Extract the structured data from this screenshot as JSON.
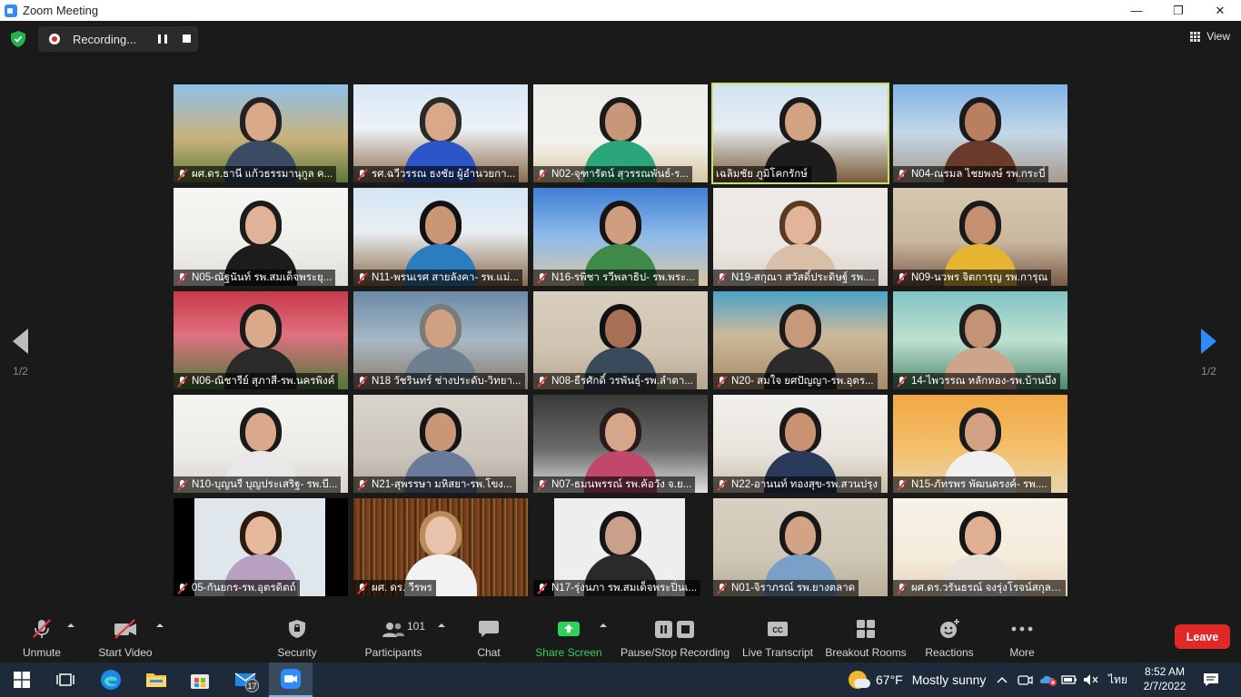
{
  "window": {
    "title": "Zoom Meeting"
  },
  "recording": {
    "label": "Recording..."
  },
  "view": {
    "label": "View"
  },
  "pages": {
    "left": "1/2",
    "right": "1/2"
  },
  "participants_tiles": [
    "ผศ.ดร.ธานี แก้วธรรมานุกูล ค...",
    "รศ.ฉวีวรรณ ธงชัย ผู้อำนวยกา...",
    "N02-จุฑารัตน์ สุวรรณพันธ์-ร...",
    "เฉลิมชัย ภูมิโคกรักษ์",
    "N04-ณรมล ไชยพงษ์ รพ.กระบี่",
    "N05-ณัฐนันท์ รพ.สมเด็จพระยุ...",
    "N11-พรนเรศ สายลังคา- รพ.แม่...",
    "N16-รพิชา รวีพลาธิป- รพ.พระ...",
    "N19-สกุณา สวัสดิ์ประดิษฐ์ รพ....",
    "N09-นวพร จิตการุญ รพ.การุณ",
    "N06-ณิชารีย์ สุภาสี-รพ.นครพิงค์",
    "N18 วัชรินทร์ ช่างประดับ-วิทยา...",
    "N08-ธีรศักดิ์ วรพันธุ์-รพ.ลำตา...",
    "N20- สมใจ ยศปัญญา-รพ.อุตร...",
    "14-ไพวรรณ หลักทอง-รพ.บ้านบึง",
    "N10-บุญนรี บุญประเสริฐ- รพ.บี...",
    "N21-สุพรรษา มหิสยา-รพ.โขง...",
    "N07-ธมนพรรณ์ รพ.ค้อวัง จ.ย...",
    "N22-อานนท์ ทองสุข-รพ.สวนปรุง",
    "N15-ภัทรพร พัฒนดรงค์- รพ....",
    "05-กันยกร-รพ.อุตรดิตถ์",
    "ผศ. ดร. วีรพร",
    "N17-รุ่งนภา รพ.สมเด็จพระปิ่นเ...",
    "N01-จิราภรณ์ รพ.ยางตลาด",
    "ผศ.ดร.วรันธรณ์ จงรุ่งโรจน์สกุล ..."
  ],
  "toolbar": {
    "unmute": "Unmute",
    "start_video": "Start Video",
    "security": "Security",
    "participants": "Participants",
    "participants_count": "101",
    "chat": "Chat",
    "share_screen": "Share Screen",
    "pause_stop": "Pause/Stop Recording",
    "live_transcript": "Live Transcript",
    "breakout": "Breakout Rooms",
    "reactions": "Reactions",
    "more": "More",
    "leave": "Leave"
  },
  "taskbar": {
    "mail_badge": "17",
    "weather_temp": "67°F",
    "weather_text": "Mostly sunny",
    "ime": "ไทย",
    "time": "8:52 AM",
    "date": "2/7/2022"
  },
  "colors": {
    "accent_blue": "#2d8cff",
    "leave_red": "#e02828",
    "share_green": "#2fd25a",
    "active_speaker": "#c6e35a"
  }
}
